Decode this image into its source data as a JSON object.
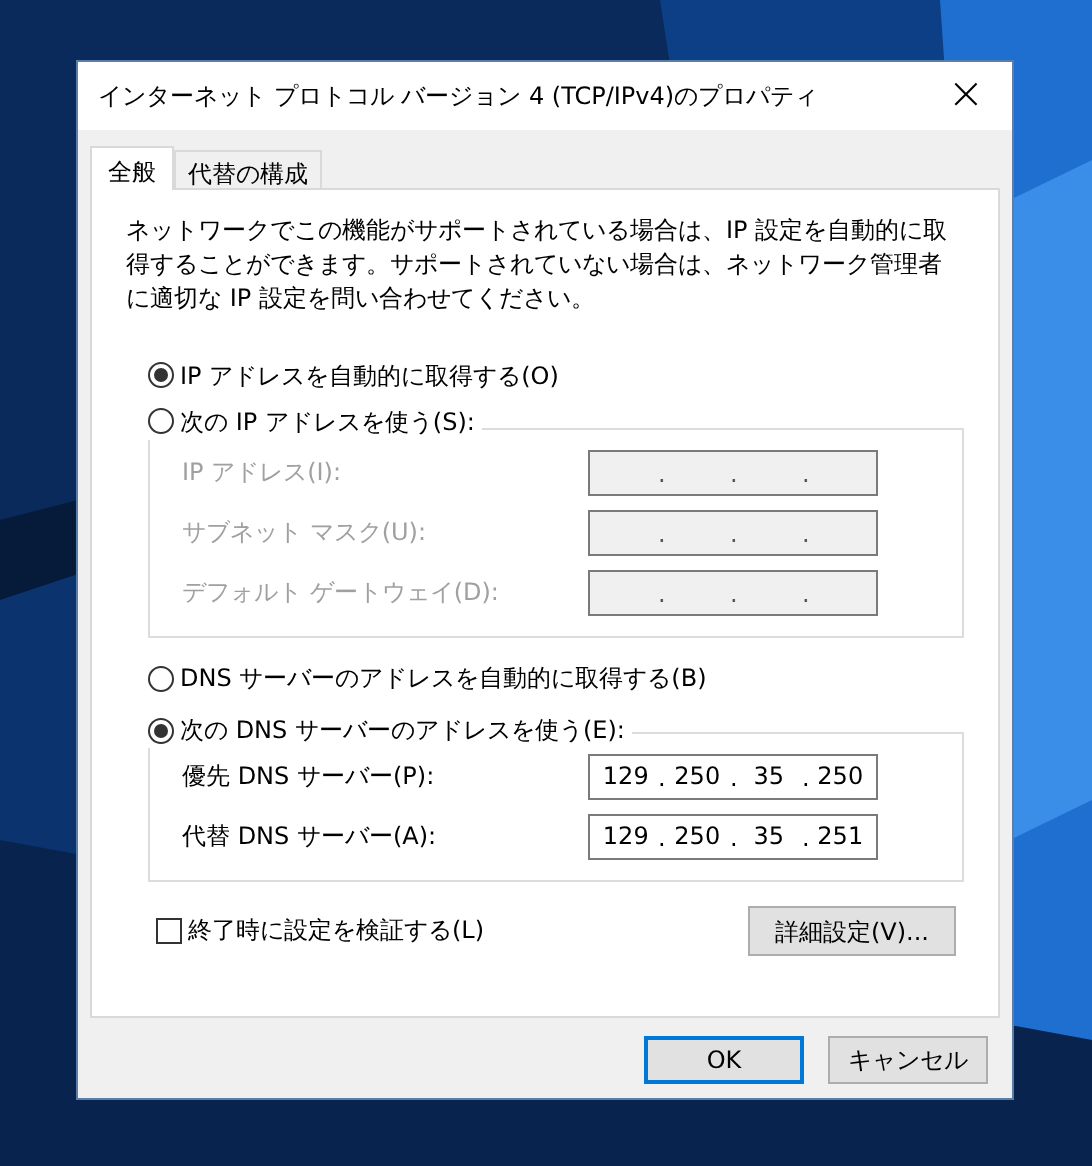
{
  "window": {
    "title": "インターネット プロトコル バージョン 4 (TCP/IPv4)のプロパティ",
    "close": "×"
  },
  "tabs": [
    {
      "label": "全般",
      "selected": true
    },
    {
      "label": "代替の構成",
      "selected": false
    }
  ],
  "description": "ネットワークでこの機能がサポートされている場合は、IP 設定を自動的に取得することができます。サポートされていない場合は、ネットワーク管理者に適切な IP 設定を問い合わせてください。",
  "sections": [
    {
      "auto_option": {
        "label": "IP アドレスを自動的に取得する(O)",
        "selected": true
      },
      "manual_option": {
        "label": "次の IP アドレスを使う(S):",
        "selected": false
      },
      "fields": [
        {
          "label": "IP アドレス(I):",
          "disabled": true,
          "separators": [
            ".",
            ".",
            "."
          ]
        },
        {
          "label": "サブネット マスク(U):",
          "disabled": true,
          "separators": [
            ".",
            ".",
            "."
          ]
        },
        {
          "label": "デフォルト ゲートウェイ(D):",
          "disabled": true,
          "separators": [
            ".",
            ".",
            "."
          ]
        }
      ]
    },
    {
      "auto_option": {
        "label": "DNS サーバーのアドレスを自動的に取得する(B)",
        "selected": false
      },
      "manual_option": {
        "label": "次の DNS サーバーのアドレスを使う(E):",
        "selected": true
      },
      "fields": [
        {
          "label": "優先 DNS サーバー(P):",
          "disabled": false,
          "octets": [
            "129",
            "250",
            "35",
            "250"
          ],
          "separators": [
            ".",
            ".",
            "."
          ]
        },
        {
          "label": "代替 DNS サーバー(A):",
          "disabled": false,
          "octets": [
            "129",
            "250",
            "35",
            "251"
          ],
          "separators": [
            ".",
            ".",
            "."
          ]
        }
      ]
    }
  ],
  "validate_checkbox": {
    "label": "終了時に設定を検証する(L)",
    "checked": false
  },
  "advanced_button": "詳細設定(V)...",
  "buttons": [
    {
      "label": "OK",
      "kind": "default"
    },
    {
      "label": "キャンセル",
      "kind": "normal"
    }
  ]
}
